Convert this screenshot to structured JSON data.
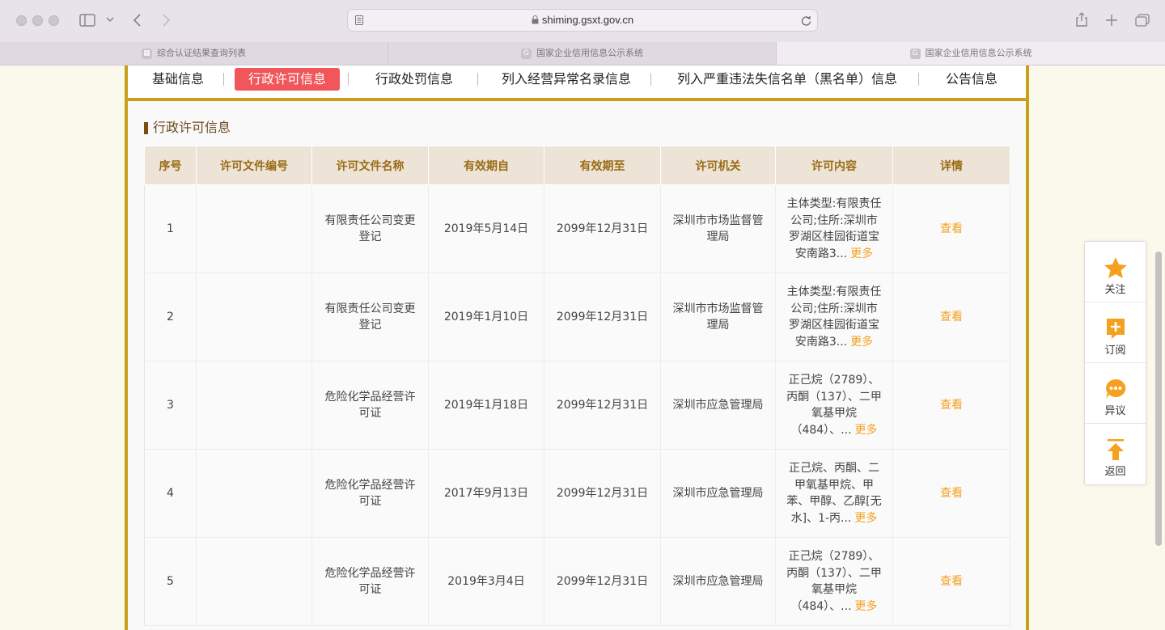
{
  "browser": {
    "url": "shiming.gsxt.gov.cn",
    "tabs": [
      {
        "label": "综合认证结果查询列表",
        "icon": "grid-favicon"
      },
      {
        "label": "国家企业信用信息公示系统",
        "icon": "gsxt-favicon"
      },
      {
        "label": "国家企业信用信息公示系统",
        "icon": "gsxt-favicon"
      }
    ]
  },
  "nav": {
    "items": [
      "基础信息",
      "行政许可信息",
      "行政处罚信息",
      "列入经营异常名录信息",
      "列入严重违法失信名单（黑名单）信息",
      "公告信息"
    ],
    "active": "行政许可信息"
  },
  "section": {
    "title": "行政许可信息"
  },
  "table": {
    "headers": [
      "序号",
      "许可文件编号",
      "许可文件名称",
      "有效期自",
      "有效期至",
      "许可机关",
      "许可内容",
      "详情"
    ],
    "rows": [
      {
        "no": "1",
        "file_no": "",
        "name": "有限责任公司变更登记",
        "from": "2019年5月14日",
        "to": "2099年12月31日",
        "authority": "深圳市市场监督管理局",
        "content": "主体类型:有限责任公司;住所:深圳市罗湖区桂园街道宝安南路3...",
        "more": "更多",
        "detail": "查看"
      },
      {
        "no": "2",
        "file_no": "",
        "name": "有限责任公司变更登记",
        "from": "2019年1月10日",
        "to": "2099年12月31日",
        "authority": "深圳市市场监督管理局",
        "content": "主体类型:有限责任公司;住所:深圳市罗湖区桂园街道宝安南路3...",
        "more": "更多",
        "detail": "查看"
      },
      {
        "no": "3",
        "file_no": "",
        "name": "危险化学品经营许可证",
        "from": "2019年1月18日",
        "to": "2099年12月31日",
        "authority": "深圳市应急管理局",
        "content": "正己烷（2789）、丙酮（137）、二甲氧基甲烷（484）、...",
        "more": "更多",
        "detail": "查看"
      },
      {
        "no": "4",
        "file_no": "",
        "name": "危险化学品经营许可证",
        "from": "2017年9月13日",
        "to": "2099年12月31日",
        "authority": "深圳市应急管理局",
        "content": "正己烷、丙酮、二甲氧基甲烷、甲苯、甲醇、乙醇[无水]、1-丙...",
        "more": "更多",
        "detail": "查看"
      },
      {
        "no": "5",
        "file_no": "",
        "name": "危险化学品经营许可证",
        "from": "2019年3月4日",
        "to": "2099年12月31日",
        "authority": "深圳市应急管理局",
        "content": "正己烷（2789）、丙酮（137）、二甲氧基甲烷（484）、...",
        "more": "更多",
        "detail": "查看"
      }
    ]
  },
  "side_panel": [
    {
      "label": "关注",
      "icon": "star-icon"
    },
    {
      "label": "订阅",
      "icon": "subscribe-icon"
    },
    {
      "label": "异议",
      "icon": "chat-bubble-icon"
    },
    {
      "label": "返回",
      "icon": "back-to-top-icon"
    }
  ],
  "colors": {
    "accent": "#c9a01c",
    "active_tab": "#f1565b",
    "link": "#f5a01e",
    "header_bg": "#ede4d7",
    "header_text": "#9a6b14",
    "side_icon": "#f5a01e"
  }
}
